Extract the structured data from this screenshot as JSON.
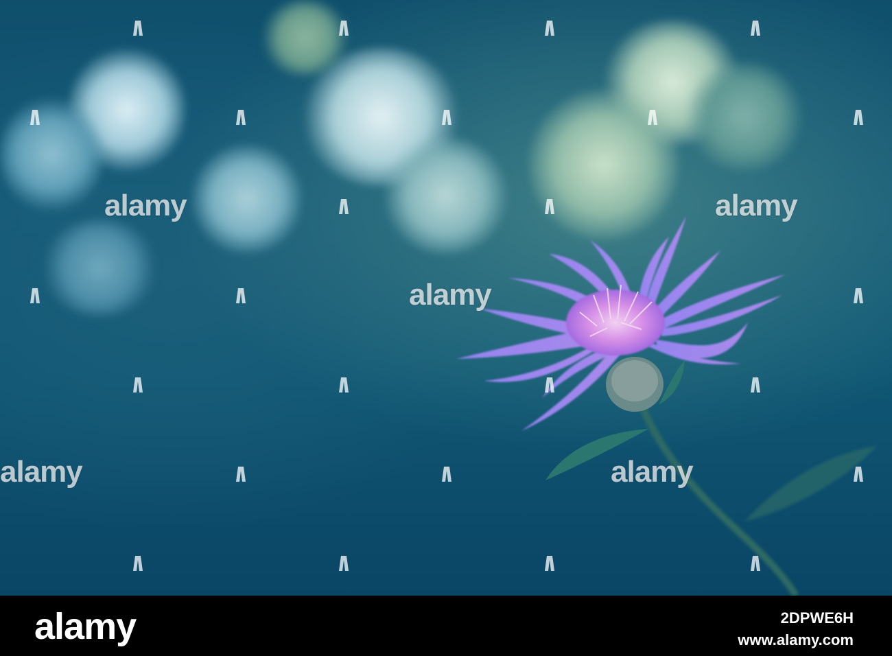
{
  "watermark": {
    "text": "alamy"
  },
  "footer": {
    "logo": "alamy",
    "image_id": "2DPWE6H",
    "site": "www.alamy.com"
  },
  "colors": {
    "background_dark_teal": "#0f4f6c",
    "bokeh_light": "#cfe7ef",
    "petal_violet": "#8a78f0",
    "petal_pink": "#d79be9",
    "stem_green": "#2f6a63",
    "footer_black": "#000000"
  }
}
